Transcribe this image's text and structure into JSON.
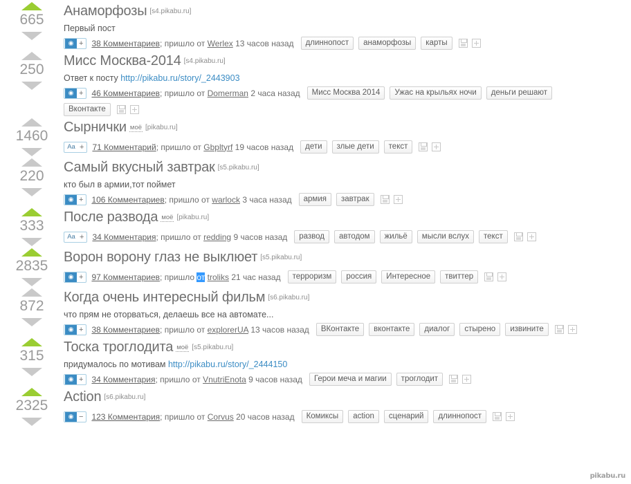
{
  "site": {
    "watermark": "pikabu.ru"
  },
  "icons": {
    "upvote": "arrow-up-icon",
    "downvote": "arrow-down-icon",
    "camera": "camera-icon",
    "text": "Aa",
    "plus": "+",
    "minus": "−",
    "save": "save-icon",
    "addbox": "add-to-box-icon"
  },
  "colors": {
    "hot_arrow": "#9acd32",
    "idle_arrow": "#c9c9c9",
    "link": "#3b8cc4",
    "title": "#6f6f6f",
    "selection": "#3399ff"
  },
  "stories": [
    {
      "rating": "665",
      "hot": true,
      "title": "Анаморфозы",
      "mine": null,
      "source": "[s4.pikabu.ru]",
      "desc": "Первый пост",
      "desc_link": null,
      "type": "photo",
      "vote_sign": "+",
      "comments": "38 Комментариев",
      "from_label": "пришло от",
      "author": "Werlex",
      "time": "13 часов назад",
      "selected_word": null,
      "tags": [
        "длиннопост",
        "анаморфозы",
        "карты"
      ],
      "tags_row2": []
    },
    {
      "rating": "250",
      "hot": false,
      "title": "Мисс Москва-2014",
      "mine": null,
      "source": "[s4.pikabu.ru]",
      "desc": "Ответ к посту ",
      "desc_link": "http://pikabu.ru/story/_2443903",
      "type": "photo",
      "vote_sign": "+",
      "comments": "46 Комментариев",
      "from_label": "пришло от",
      "author": "Domerman",
      "time": "2 часа назад",
      "selected_word": null,
      "tags": [
        "Мисс Москва 2014",
        "Ужас на крыльях ночи",
        "деньги решают"
      ],
      "tags_row2": [
        "Вконтакте"
      ]
    },
    {
      "rating": "1460",
      "hot": false,
      "title": "Сырнички",
      "mine": "моё",
      "source": "[pikabu.ru]",
      "desc": null,
      "desc_link": null,
      "type": "text",
      "vote_sign": "+",
      "comments": "71 Комментарий",
      "from_label": "пришло от",
      "author": "Gbpltyrf",
      "time": "19 часов назад",
      "selected_word": null,
      "tags": [
        "дети",
        "злые дети",
        "текст"
      ],
      "tags_row2": []
    },
    {
      "rating": "220",
      "hot": false,
      "title": "Самый вкусный завтрак",
      "mine": null,
      "source": "[s5.pikabu.ru]",
      "desc": "кто был в армии,тот поймет",
      "desc_link": null,
      "type": "photo",
      "vote_sign": "+",
      "comments": "106 Комментариев",
      "from_label": "пришло от",
      "author": "warlock",
      "time": "3 часа назад",
      "selected_word": null,
      "tags": [
        "армия",
        "завтрак"
      ],
      "tags_row2": []
    },
    {
      "rating": "333",
      "hot": true,
      "title": "После развода",
      "mine": "моё",
      "source": "[pikabu.ru]",
      "desc": null,
      "desc_link": null,
      "type": "text",
      "vote_sign": "+",
      "comments": "34 Комментария",
      "from_label": "пришло от",
      "author": "redding",
      "time": "9 часов назад",
      "selected_word": null,
      "tags": [
        "развод",
        "автодом",
        "жильё",
        "мысли вслух",
        "текст"
      ],
      "tags_row2": []
    },
    {
      "rating": "2835",
      "hot": true,
      "title": "Ворон ворону глаз не выклюет",
      "mine": null,
      "source": "[s5.pikabu.ru]",
      "desc": null,
      "desc_link": null,
      "type": "photo",
      "vote_sign": "+",
      "comments": "97 Комментариев",
      "from_label": "пришло",
      "author": "troliks",
      "time": "21 час назад",
      "selected_word": "от",
      "tags": [
        "терроризм",
        "россия",
        "Интересное",
        "твиттер"
      ],
      "tags_row2": []
    },
    {
      "rating": "872",
      "hot": false,
      "title": "Когда очень интересный фильм",
      "mine": null,
      "source": "[s6.pikabu.ru]",
      "desc": "что прям не оторваться, делаешь все на автомате...",
      "desc_link": null,
      "type": "photo",
      "vote_sign": "+",
      "comments": "38 Комментариев",
      "from_label": "пришло от",
      "author": "explorerUA",
      "time": "13 часов назад",
      "selected_word": null,
      "tags": [
        "ВКонтакте",
        "вконтакте",
        "диалог",
        "стырено",
        "извините"
      ],
      "tags_row2": []
    },
    {
      "rating": "315",
      "hot": true,
      "title": "Тоска троглодита",
      "mine": "моё",
      "source": "[s5.pikabu.ru]",
      "desc": "придумалось по мотивам ",
      "desc_link": "http://pikabu.ru/story/_2444150",
      "type": "photo",
      "vote_sign": "+",
      "comments": "34 Комментария",
      "from_label": "пришло от",
      "author": "VnutriEnota",
      "time": "9 часов назад",
      "selected_word": null,
      "tags": [
        "Герои меча и магии",
        "троглодит"
      ],
      "tags_row2": []
    },
    {
      "rating": "2325",
      "hot": true,
      "title": "Action",
      "mine": null,
      "source": "[s6.pikabu.ru]",
      "desc": null,
      "desc_link": null,
      "type": "photo",
      "vote_sign": "−",
      "comments": "123 Комментария",
      "from_label": "пришло от",
      "author": "Corvus",
      "time": "20 часов назад",
      "selected_word": null,
      "tags": [
        "Комиксы",
        "action",
        "сценарий",
        "длиннопост"
      ],
      "tags_row2": []
    }
  ]
}
